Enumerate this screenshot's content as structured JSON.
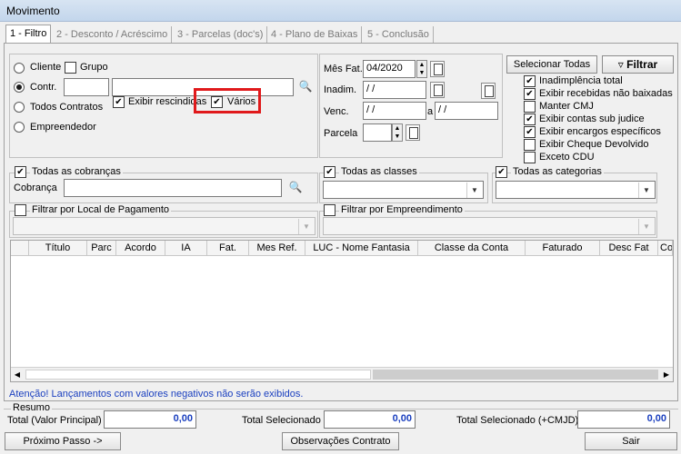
{
  "window": {
    "title": "Movimento"
  },
  "tabs": [
    {
      "label": "1 - Filtro"
    },
    {
      "label": "2 - Desconto / Acréscimo"
    },
    {
      "label": "3 - Parcelas (doc's)"
    },
    {
      "label": "4 - Plano de Baixas"
    },
    {
      "label": "5 - Conclusão"
    }
  ],
  "filter": {
    "cliente_label": "Cliente",
    "grupo_label": "Grupo",
    "contr_label": "Contr.",
    "todos_contratos_label": "Todos Contratos",
    "empreendedor_label": "Empreendedor",
    "exibir_rescindidos_label": "Exibir rescindidas",
    "varios_label": "Vários",
    "mes_fat_label": "Mês Fat.",
    "mes_fat_value": "04/2020",
    "inadim_label": "Inadim.",
    "inadim_value": " /  /",
    "venc_label": "Venc.",
    "venc_from": " /  /",
    "venc_sep": "a",
    "venc_to": " /  /",
    "parcela_label": "Parcela",
    "selecionar_todas": "Selecionar Todas",
    "filtrar": "Filtrar",
    "options": [
      {
        "label": "Inadimplência total",
        "checked": true
      },
      {
        "label": "Exibir recebidas não baixadas",
        "checked": true
      },
      {
        "label": "Manter CMJ",
        "checked": false
      },
      {
        "label": "Exibir contas sub judice",
        "checked": true
      },
      {
        "label": "Exibir encargos específicos",
        "checked": true
      },
      {
        "label": "Exibir Cheque Devolvido",
        "checked": false
      },
      {
        "label": "Exceto CDU",
        "checked": false
      }
    ],
    "todas_cobrancas_label": "Todas as cobranças",
    "cobranca_label": "Cobrança",
    "todas_classes_label": "Todas as classes",
    "todas_categorias_label": "Todas as categorias",
    "filtrar_local_label": "Filtrar por Local de Pagamento",
    "filtrar_empreendimento_label": "Filtrar por Empreendimento"
  },
  "grid": {
    "columns": [
      "Título",
      "Parc",
      "Acordo",
      "IA",
      "Fat.",
      "Mes Ref.",
      "LUC - Nome Fantasia",
      "Classe da Conta",
      "Faturado",
      "Desc Fat",
      "Co"
    ]
  },
  "warning": "Atenção! Lançamentos com valores negativos não serão exibidos.",
  "resumo": {
    "title": "Resumo",
    "total_principal_label": "Total (Valor Principal)",
    "total_principal_value": "0,00",
    "total_selecionado_label": "Total Selecionado",
    "total_selecionado_value": "0,00",
    "total_cmjd_label": "Total Selecionado (+CMJD)",
    "total_cmjd_value": "0,00"
  },
  "footer": {
    "proximo": "Próximo Passo ->",
    "observacoes": "Observações Contrato",
    "sair": "Sair"
  },
  "colors": {
    "highlight": "#e0191b",
    "warning_text": "#1a3fbf",
    "value_text": "#1a3fbf"
  }
}
